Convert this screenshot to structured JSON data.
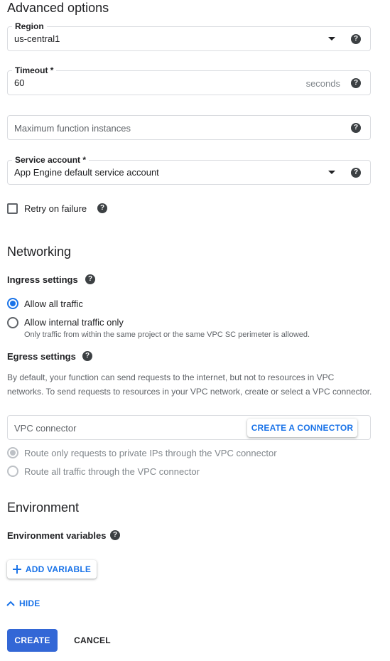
{
  "advanced": {
    "title": "Advanced options",
    "region": {
      "label": "Region",
      "value": "us-central1"
    },
    "timeout": {
      "label": "Timeout *",
      "value": "60",
      "suffix": "seconds"
    },
    "max_instances": {
      "placeholder": "Maximum function instances"
    },
    "service_account": {
      "label": "Service account *",
      "value": "App Engine default service account"
    },
    "retry": {
      "label": "Retry on failure",
      "checked": false
    }
  },
  "networking": {
    "title": "Networking",
    "ingress": {
      "title": "Ingress settings",
      "options": [
        {
          "label": "Allow all traffic",
          "selected": true
        },
        {
          "label": "Allow internal traffic only",
          "selected": false,
          "hint": "Only traffic from within the same project or the same VPC SC perimeter is allowed."
        }
      ]
    },
    "egress": {
      "title": "Egress settings",
      "description_line1": "By default, your function can send requests to the internet, but not to resources in VPC",
      "description_line2": "networks. To send requests to resources in your VPC network, create or select a VPC connector.",
      "vpc_placeholder": "VPC connector",
      "create_connector_label": "CREATE A CONNECTOR",
      "options": [
        {
          "label": "Route only requests to private IPs through the VPC connector",
          "selected": true,
          "disabled": true
        },
        {
          "label": "Route all traffic through the VPC connector",
          "selected": false,
          "disabled": true
        }
      ]
    }
  },
  "environment": {
    "title": "Environment",
    "variables_title": "Environment variables",
    "add_variable_label": "ADD VARIABLE"
  },
  "footer": {
    "hide_label": "HIDE",
    "create_label": "CREATE",
    "cancel_label": "CANCEL"
  },
  "icons": {
    "help": "help-icon",
    "dropdown": "chevron-down-icon",
    "plus": "plus-icon",
    "hide": "chevron-up-icon"
  },
  "colors": {
    "accent": "#1a73e8",
    "primary_button": "#3367d6",
    "border": "#dadce0",
    "muted_text": "#5f6368"
  }
}
